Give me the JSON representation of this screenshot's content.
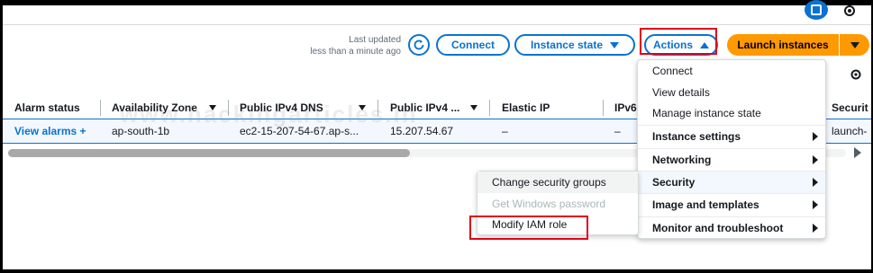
{
  "toolbar": {
    "last_updated_line1": "Last updated",
    "last_updated_line2": "less than a minute ago",
    "connect_label": "Connect",
    "instance_state_label": "Instance state",
    "actions_label": "Actions",
    "launch_label": "Launch instances"
  },
  "table": {
    "columns": [
      "Alarm status",
      "Availability Zone",
      "Public IPv4 DNS",
      "Public IPv4 ...",
      "Elastic IP",
      "IPv6",
      "Securit"
    ],
    "row": {
      "alarm": "View alarms +",
      "az": "ap-south-1b",
      "dns": "ec2-15-207-54-67.ap-s...",
      "ip": "15.207.54.67",
      "elastic": "–",
      "ipv6": "–",
      "security": "launch-"
    }
  },
  "watermark": "www.hackingarticles.in",
  "actions_menu": {
    "items": [
      {
        "label": "Connect",
        "bold": false,
        "submenu": false
      },
      {
        "label": "View details",
        "bold": false,
        "submenu": false
      },
      {
        "label": "Manage instance state",
        "bold": false,
        "submenu": false
      },
      {
        "label": "Instance settings",
        "bold": true,
        "submenu": true
      },
      {
        "label": "Networking",
        "bold": true,
        "submenu": true
      },
      {
        "label": "Security",
        "bold": true,
        "submenu": true,
        "active": true
      },
      {
        "label": "Image and templates",
        "bold": true,
        "submenu": true
      },
      {
        "label": "Monitor and troubleshoot",
        "bold": true,
        "submenu": true
      }
    ]
  },
  "security_submenu": {
    "items": [
      {
        "label": "Change security groups",
        "disabled": false
      },
      {
        "label": "Get Windows password",
        "disabled": true
      },
      {
        "label": "Modify IAM role",
        "disabled": false
      }
    ]
  },
  "colors": {
    "accent": "#0972d3",
    "launch": "#ff9900",
    "highlight": "#e0001b"
  }
}
